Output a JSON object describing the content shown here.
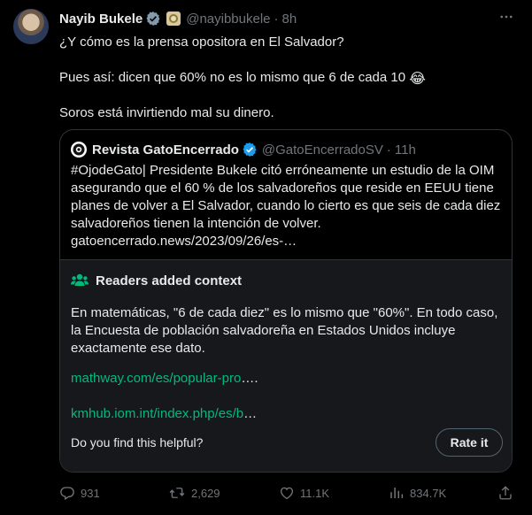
{
  "tweet": {
    "author_name": "Nayib Bukele",
    "author_handle": "@nayibbukele",
    "separator": "·",
    "time": "8h",
    "lines": [
      "¿Y cómo es la prensa opositora en El Salvador?",
      "Pues así: dicen que 60% no es lo mismo que 6 de cada 10",
      "Soros está invirtiendo mal su dinero."
    ],
    "emoji": "😂"
  },
  "quote": {
    "author_name": "Revista GatoEncerrado",
    "author_handle": "@GatoEncerradoSV",
    "separator": "·",
    "time": "11h",
    "text": "#OjodeGato| Presidente Bukele citó erróneamente un estudio de la OIM asegurando que el 60 % de los salvadoreños que reside en EEUU tiene planes de volver a El Salvador, cuando lo cierto es que seis de cada diez salvadoreños tienen la intención de volver. gatoencerrado.news/2023/09/26/es-…"
  },
  "context_note": {
    "title": "Readers added context",
    "body": "En matemáticas, \"6 de cada diez\" es lo mismo que \"60%\". En todo caso, la Encuesta de población salvadoreña en Estados Unidos incluye exactamente ese dato.",
    "link1": "mathway.com/es/popular-pro",
    "link1_suffix": "….",
    "link2": "kmhub.iom.int/index.php/es/b",
    "link2_suffix": "…",
    "helpful_question": "Do you find this helpful?",
    "rate_label": "Rate it"
  },
  "actions": {
    "replies": "931",
    "reposts": "2,629",
    "likes": "11.1K",
    "views": "834.7K"
  },
  "colors": {
    "background": "#000000",
    "text": "#e7e9ea",
    "secondary": "#71767b",
    "verified": "#1d9bf0",
    "link_green": "#00ba7c",
    "note_background": "#16181c"
  },
  "icons": [
    "verified-badge-icon",
    "affiliate-badge-icon",
    "more-icon",
    "gatoencerrado-logo-icon",
    "readers-context-icon",
    "reply-icon",
    "repost-icon",
    "like-icon",
    "views-icon",
    "share-icon"
  ]
}
